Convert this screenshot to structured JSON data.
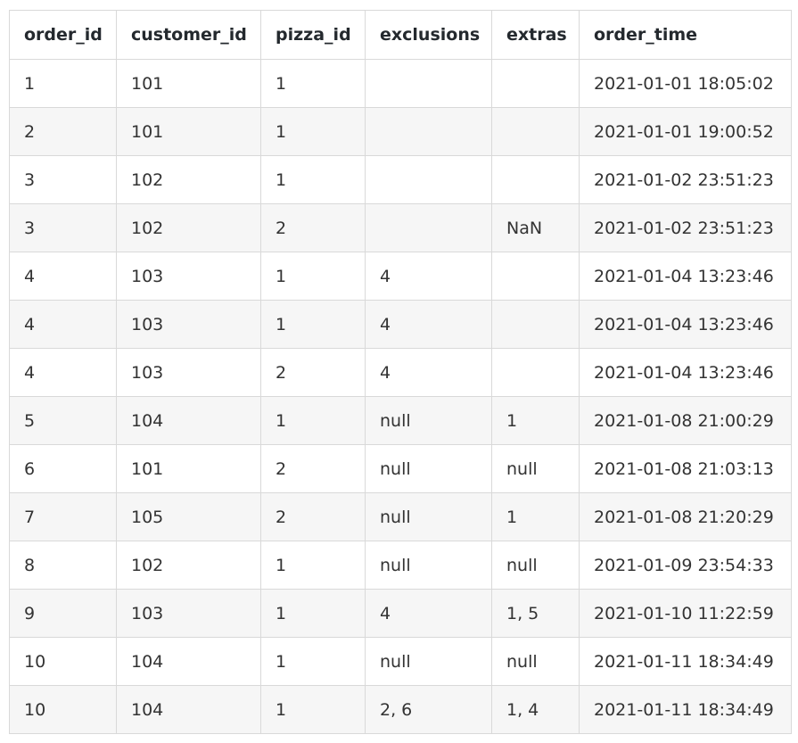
{
  "table": {
    "columns": [
      "order_id",
      "customer_id",
      "pizza_id",
      "exclusions",
      "extras",
      "order_time"
    ],
    "rows": [
      [
        "1",
        "101",
        "1",
        "",
        "",
        "2021-01-01 18:05:02"
      ],
      [
        "2",
        "101",
        "1",
        "",
        "",
        "2021-01-01 19:00:52"
      ],
      [
        "3",
        "102",
        "1",
        "",
        "",
        "2021-01-02 23:51:23"
      ],
      [
        "3",
        "102",
        "2",
        "",
        "NaN",
        "2021-01-02 23:51:23"
      ],
      [
        "4",
        "103",
        "1",
        "4",
        "",
        "2021-01-04 13:23:46"
      ],
      [
        "4",
        "103",
        "1",
        "4",
        "",
        "2021-01-04 13:23:46"
      ],
      [
        "4",
        "103",
        "2",
        "4",
        "",
        "2021-01-04 13:23:46"
      ],
      [
        "5",
        "104",
        "1",
        "null",
        "1",
        "2021-01-08 21:00:29"
      ],
      [
        "6",
        "101",
        "2",
        "null",
        "null",
        "2021-01-08 21:03:13"
      ],
      [
        "7",
        "105",
        "2",
        "null",
        "1",
        "2021-01-08 21:20:29"
      ],
      [
        "8",
        "102",
        "1",
        "null",
        "null",
        "2021-01-09 23:54:33"
      ],
      [
        "9",
        "103",
        "1",
        "4",
        "1, 5",
        "2021-01-10 11:22:59"
      ],
      [
        "10",
        "104",
        "1",
        "null",
        "null",
        "2021-01-11 18:34:49"
      ],
      [
        "10",
        "104",
        "1",
        "2, 6",
        "1, 4",
        "2021-01-11 18:34:49"
      ]
    ]
  },
  "colors": {
    "border": "#d9d9d9",
    "stripe": "#f6f6f6",
    "header_text": "#24292e",
    "cell_text": "#333333"
  }
}
